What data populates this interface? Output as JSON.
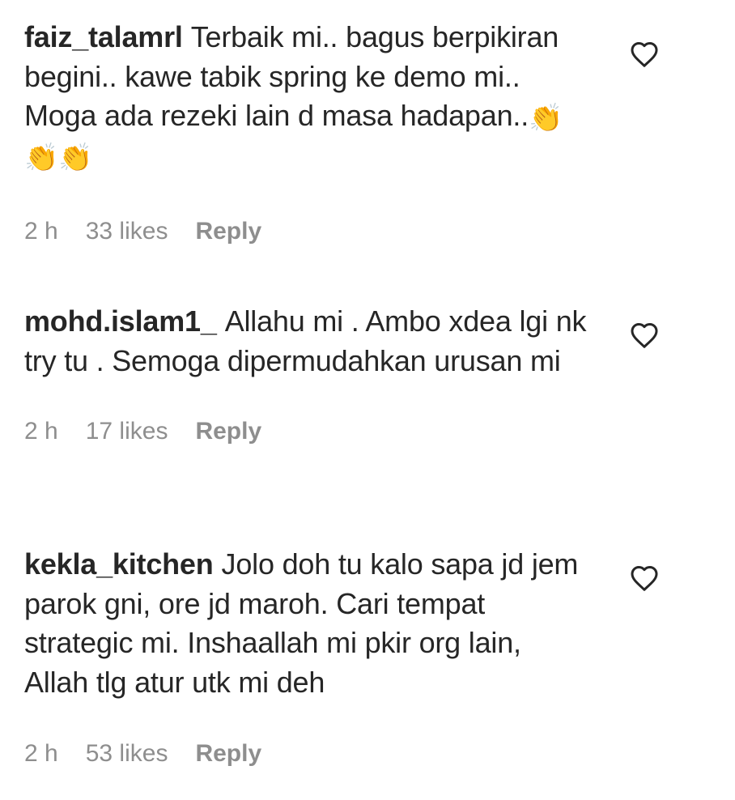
{
  "comments": [
    {
      "username": "faiz_talamrl",
      "text": "Terbaik mi.. bagus berpikiran begini.. kawe tabik spring ke demo mi.. Moga ada rezeki lain d masa hadapan..",
      "emojis": [
        "👏",
        "👏",
        "👏"
      ],
      "time": "2 h",
      "likes": "33 likes",
      "reply": "Reply"
    },
    {
      "username": "mohd.islam1_",
      "text": "Allahu mi . Ambo xdea lgi nk try tu . Semoga dipermudahkan urusan mi",
      "time": "2 h",
      "likes": "17 likes",
      "reply": "Reply"
    },
    {
      "username": "kekla_kitchen",
      "text": "Jolo doh tu kalo sapa jd jem parok gni, ore jd maroh. Cari tempat strategic mi. Inshaallah mi pkir org lain, Allah tlg atur utk mi deh",
      "time": "2 h",
      "likes": "53 likes",
      "reply": "Reply"
    }
  ],
  "icons": {
    "like": "heart-outline-icon",
    "emoji": "clapping-hands"
  },
  "colors": {
    "text": "#262626",
    "meta": "#8e8e8e",
    "heart_stroke": "#262626"
  }
}
